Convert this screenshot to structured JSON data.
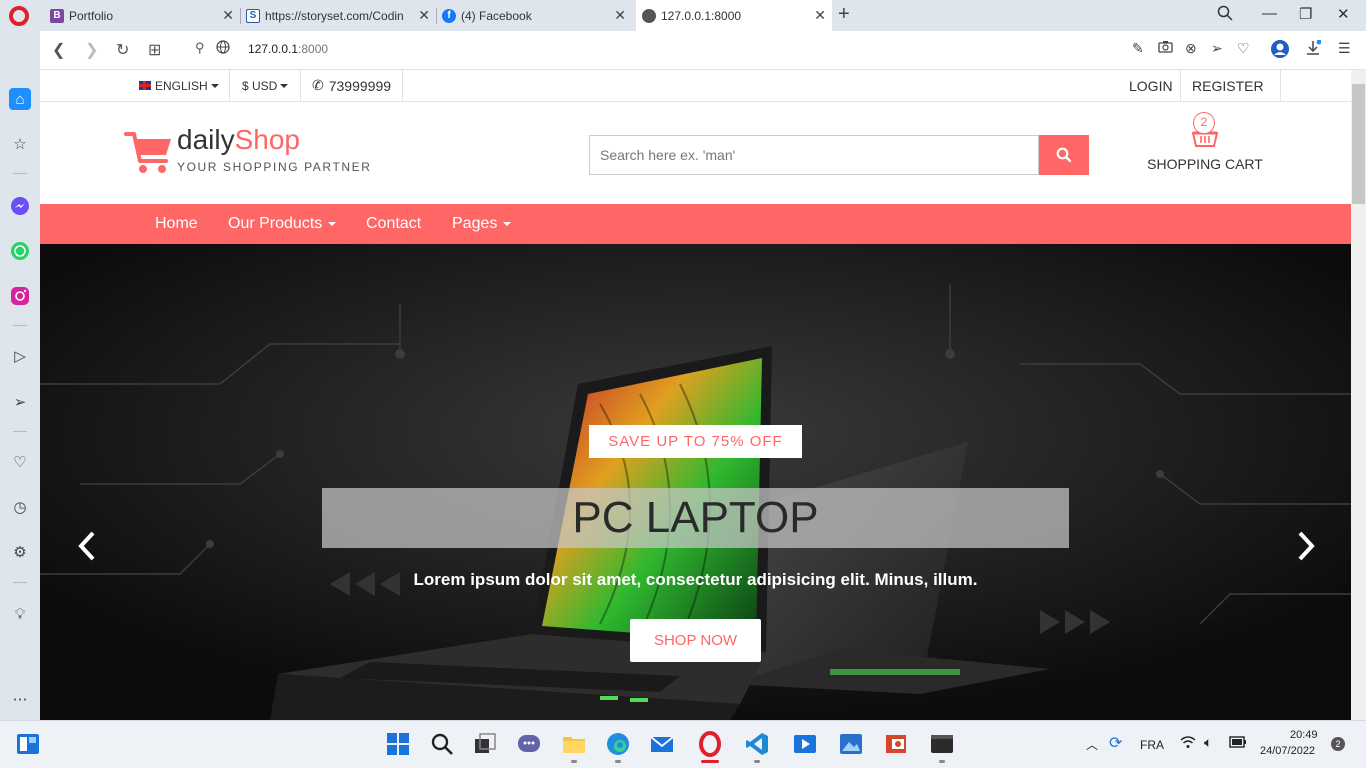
{
  "browser": {
    "tabs": [
      {
        "title": "Portfolio",
        "favicon": "B",
        "color": "#7b4aa0"
      },
      {
        "title": "https://storyset.com/Codin",
        "favicon": "S",
        "color": "#2a5c9e"
      },
      {
        "title": "(4) Facebook",
        "favicon": "f",
        "color": "#1877f2"
      },
      {
        "title": "127.0.0.1:8000",
        "favicon": "globe",
        "color": "#555555"
      }
    ],
    "url_host": "127.0.0.1",
    "url_port": ":8000"
  },
  "site": {
    "topbar": {
      "language": "ENGLISH",
      "currency": "$ USD",
      "phone": "73999999",
      "login": "LOGIN",
      "register": "REGISTER"
    },
    "brand": {
      "name_part1": "daily",
      "name_part2": "Shop",
      "tagline": "YOUR SHOPPING PARTNER"
    },
    "search": {
      "placeholder": "Search here ex. 'man'"
    },
    "cart": {
      "count": "2",
      "label": "SHOPPING CART"
    },
    "nav": {
      "home": "Home",
      "products": "Our Products",
      "contact": "Contact",
      "pages": "Pages"
    },
    "hero": {
      "tag": "SAVE UP TO 75% OFF",
      "title": "PC LAPTOP",
      "description": "Lorem ipsum dolor sit amet, consectetur adipisicing elit. Minus, illum.",
      "button": "SHOP NOW"
    },
    "accent": "#ff6666"
  },
  "taskbar": {
    "language": "FRA",
    "time": "20:49",
    "date": "24/07/2022",
    "notifications": "2"
  }
}
